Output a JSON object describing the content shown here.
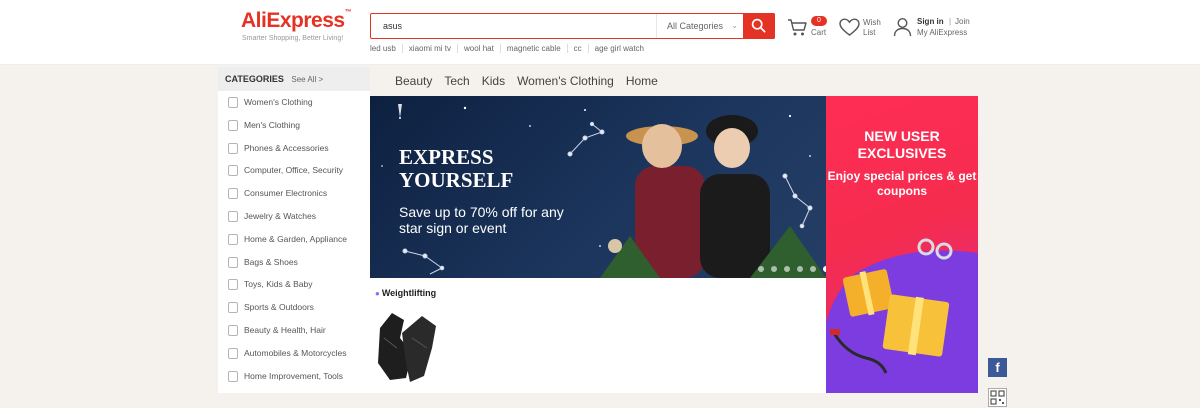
{
  "header": {
    "logo_text": "AliExpress",
    "logo_tm": "™",
    "tagline": "Smarter Shopping, Better Living!",
    "search": {
      "value": "asus",
      "category": "All Categories"
    },
    "hot_words": [
      "led usb",
      "xiaomi mi tv",
      "wool hat",
      "magnetic cable",
      "cc",
      "age girl watch"
    ],
    "cart": {
      "count": "0",
      "label": "Cart"
    },
    "wishlist": {
      "label": "Wish List"
    },
    "account": {
      "signin": "Sign in",
      "separator": "|",
      "join": "Join",
      "my_account": "My AliExpress"
    }
  },
  "sidebar": {
    "title": "CATEGORIES",
    "see_all": "See All >",
    "items": [
      {
        "label": "Women's Clothing"
      },
      {
        "label": "Men's Clothing"
      },
      {
        "label": "Phones & Accessories"
      },
      {
        "label": "Computer, Office, Security"
      },
      {
        "label": "Consumer Electronics"
      },
      {
        "label": "Jewelry & Watches"
      },
      {
        "label": "Home & Garden, Appliance"
      },
      {
        "label": "Bags & Shoes"
      },
      {
        "label": "Toys, Kids & Baby"
      },
      {
        "label": "Sports & Outdoors"
      },
      {
        "label": "Beauty & Health, Hair"
      },
      {
        "label": "Automobiles & Motorcycles"
      },
      {
        "label": "Home Improvement, Tools"
      }
    ]
  },
  "tabs": [
    "Beauty",
    "Tech",
    "Kids",
    "Women's Clothing",
    "Home"
  ],
  "banner": {
    "title_line1": "EXPRESS",
    "title_line2": "YOURSELF",
    "subtitle": "Save up to 70% off for any star sign or event",
    "slides": 6,
    "active_slide": 6
  },
  "promo": {
    "title_line1": "NEW USER",
    "title_line2": "EXCLUSIVES",
    "subtitle": "Enjoy special prices & get coupons"
  },
  "featured": {
    "label": "Weightlifting"
  },
  "social": {
    "facebook": "f"
  },
  "colors": {
    "brand": "#e43225",
    "page_bg": "#f5f1ec",
    "banner_bg": "#1c355c",
    "promo_bg": "#f52c4e",
    "facebook": "#3b5998"
  }
}
